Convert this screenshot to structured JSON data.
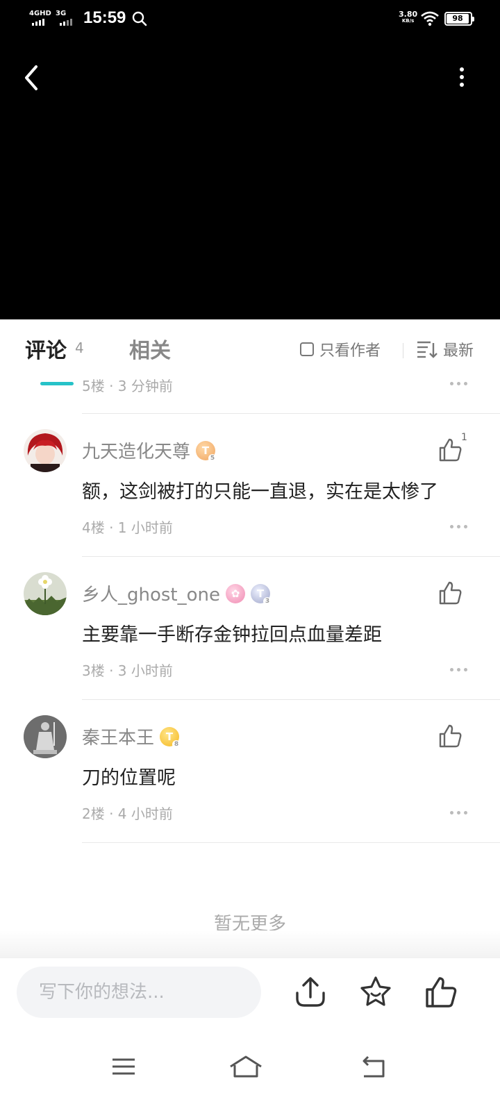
{
  "status_bar": {
    "network1": "4GHD",
    "network2": "3G",
    "time": "15:59",
    "speed_value": "3.80",
    "speed_unit": "KB/s",
    "battery": "98"
  },
  "tabs": {
    "comments_label": "评论",
    "comments_count": "4",
    "related_label": "相关",
    "author_only_label": "只看作者",
    "sort_label": "最新"
  },
  "partial_comment": {
    "meta": "5楼 · 3 分钟前"
  },
  "comments": [
    {
      "username": "九天造化天尊",
      "badges": [
        {
          "letter": "T",
          "level": "5",
          "color": "orange"
        }
      ],
      "text": "额，这剑被打的只能一直退，实在是太惨了",
      "meta": "4楼 · 1 小时前",
      "likes": "1"
    },
    {
      "username": "乡人_ghost_one",
      "badges": [
        {
          "color": "pink",
          "icon": "rabbit-icon"
        },
        {
          "letter": "T",
          "level": "3",
          "color": "silver"
        }
      ],
      "text": "主要靠一手断存金钟拉回点血量差距",
      "meta": "3楼 · 3 小时前",
      "likes": ""
    },
    {
      "username": "秦王本王",
      "badges": [
        {
          "letter": "T",
          "level": "8",
          "color": "gold"
        }
      ],
      "text": "刀的位置呢",
      "meta": "2楼 · 4 小时前",
      "likes": ""
    }
  ],
  "footer": {
    "no_more": "暂无更多"
  },
  "bottom_bar": {
    "input_placeholder": "写下你的想法...",
    "icons": [
      "share-icon",
      "star-icon",
      "thumb-up-icon"
    ]
  },
  "colors": {
    "accent": "#26c2c8",
    "text": "#222222",
    "muted": "#aaaaaa"
  }
}
